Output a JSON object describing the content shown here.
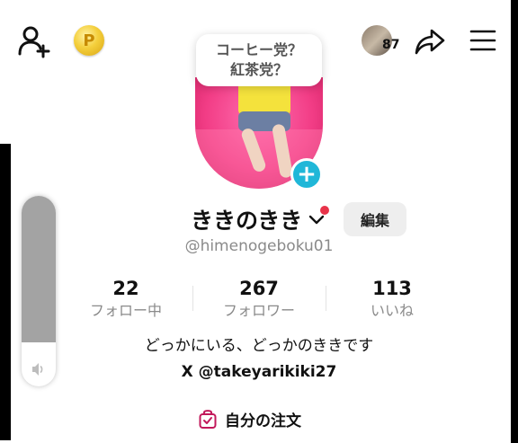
{
  "header": {
    "add_friend_icon": "add-user-icon",
    "coin_icon": "coin-icon",
    "coin_glyph": "P",
    "visitor_count": "87",
    "share_icon": "share-icon",
    "menu_icon": "menu-icon"
  },
  "bubble": {
    "line1": "コーヒー党？",
    "line2": "紅茶党？"
  },
  "profile": {
    "name": "きのきき",
    "name_prefix": "き",
    "edit_label": "編集",
    "handle": "@himenogeboku01",
    "follow_plus": "+",
    "accent_color": "#20b7d8",
    "notify_color": "#e8334a"
  },
  "stats": [
    {
      "value": "22",
      "label": "フォロー中"
    },
    {
      "value": "267",
      "label": "フォロワー"
    },
    {
      "value": "113",
      "label": "いいね"
    }
  ],
  "bio": {
    "text": "どっかにいる、どっかのききです",
    "x_link": "X @takeyarikiki27"
  },
  "orders": {
    "label": "自分の注文"
  },
  "volume": {
    "level": 0.77
  }
}
